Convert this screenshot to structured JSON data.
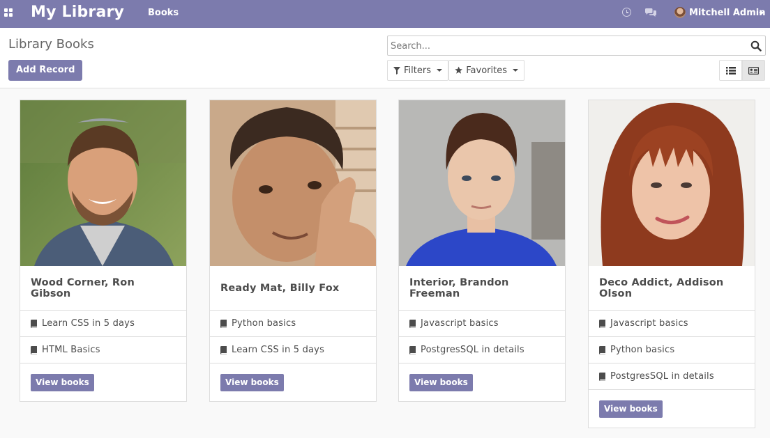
{
  "navbar": {
    "app_title": "My Library",
    "menu_books": "Books",
    "user_name": "Mitchell Admin",
    "icons": [
      "apps-icon",
      "clock-icon",
      "chat-icon"
    ]
  },
  "control_panel": {
    "breadcrumb": "Library Books",
    "add_record": "Add Record",
    "search_placeholder": "Search...",
    "filters": "Filters",
    "favorites": "Favorites",
    "views": [
      "list-view",
      "kanban-view"
    ],
    "active_view": "kanban-view"
  },
  "colors": {
    "brand": "#7c7bad",
    "background": "#f9f9f9"
  },
  "cards": [
    {
      "title": "Wood Corner, Ron Gibson",
      "books": [
        "Learn CSS in 5 days",
        "HTML Basics"
      ],
      "button": "View books"
    },
    {
      "title": "Ready Mat, Billy Fox",
      "books": [
        "Python basics",
        "Learn CSS in 5 days"
      ],
      "button": "View books"
    },
    {
      "title": "Interior, Brandon Freeman",
      "books": [
        "Javascript basics",
        "PostgresSQL in details"
      ],
      "button": "View books"
    },
    {
      "title": "Deco Addict, Addison Olson",
      "books": [
        "Javascript basics",
        "Python basics",
        "PostgresSQL in details"
      ],
      "button": "View books"
    }
  ]
}
